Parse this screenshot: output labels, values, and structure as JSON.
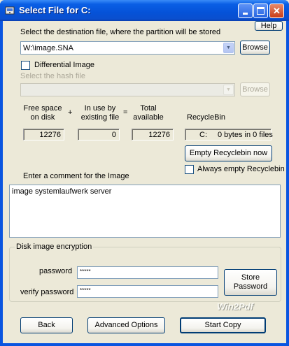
{
  "window": {
    "title": "Select File for C:",
    "help_label": "Help"
  },
  "destination": {
    "prompt": "Select the destination file, where the partition will be stored",
    "value": "W:\\image.SNA",
    "browse_label": "Browse"
  },
  "differential": {
    "label": "Differential Image",
    "checked": false
  },
  "hash": {
    "prompt": "Select the hash file",
    "value": "",
    "browse_label": "Browse"
  },
  "space": {
    "free_label": "Free space\non disk",
    "plus": "+",
    "in_use_label": "In use by\nexisting file",
    "equals": "=",
    "total_label": "Total\navailable",
    "recyclebin_label": "RecycleBin",
    "free_value": "12276",
    "in_use_value": "0",
    "total_value": "12276",
    "recycle_drive": "C:",
    "recycle_info": "0 bytes in 0 files",
    "empty_recycle_label": "Empty Recyclebin now",
    "always_empty_label": "Always empty Recyclebin"
  },
  "comment": {
    "prompt": "Enter a comment for the Image",
    "value": "image systemlaufwerk server"
  },
  "encryption": {
    "title": "Disk image encryption",
    "password_label": "password",
    "password_value": "*****",
    "verify_label": "verify password",
    "verify_value": "*****",
    "store_label": "Store\nPassword"
  },
  "footer": {
    "watermark": "Win2Pdf",
    "back_label": "Back",
    "advanced_label": "Advanced Options",
    "start_label": "Start Copy"
  }
}
